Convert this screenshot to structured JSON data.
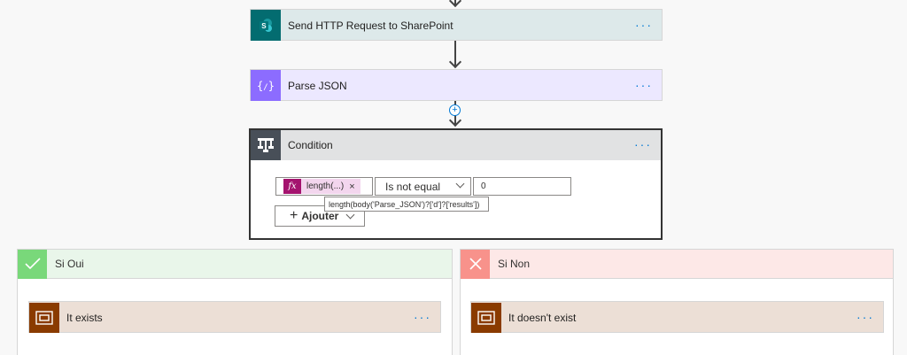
{
  "steps": {
    "sharepoint": {
      "title": "Send HTTP Request to SharePoint",
      "icon": "sharepoint-icon",
      "color": "#036c70",
      "bg": "#dde9ea"
    },
    "parse_json": {
      "title": "Parse JSON",
      "icon": "braces-icon",
      "color": "#8c6cff",
      "bg": "#ece8ff"
    },
    "condition": {
      "title": "Condition",
      "icon": "condition-icon",
      "color": "#484f58",
      "bg": "#e1e2e3"
    }
  },
  "condition_row": {
    "token_label": "length(...)",
    "token_icon": "fx",
    "operator": "Is not equal",
    "value": "0",
    "tooltip": "length(body('Parse_JSON')?['d']?['results'])",
    "add_label": "Ajouter"
  },
  "branches": {
    "yes": {
      "title": "Si Oui",
      "color": "#79d87a",
      "bg": "#e9f6ea",
      "action": {
        "title": "It exists"
      }
    },
    "no": {
      "title": "Si Non",
      "color": "#f8928b",
      "bg": "#fde8e7",
      "action": {
        "title": "It doesn't exist"
      }
    }
  },
  "action_color": "#8a3b00",
  "action_bg": "#ecdfd6",
  "more_label": "···"
}
